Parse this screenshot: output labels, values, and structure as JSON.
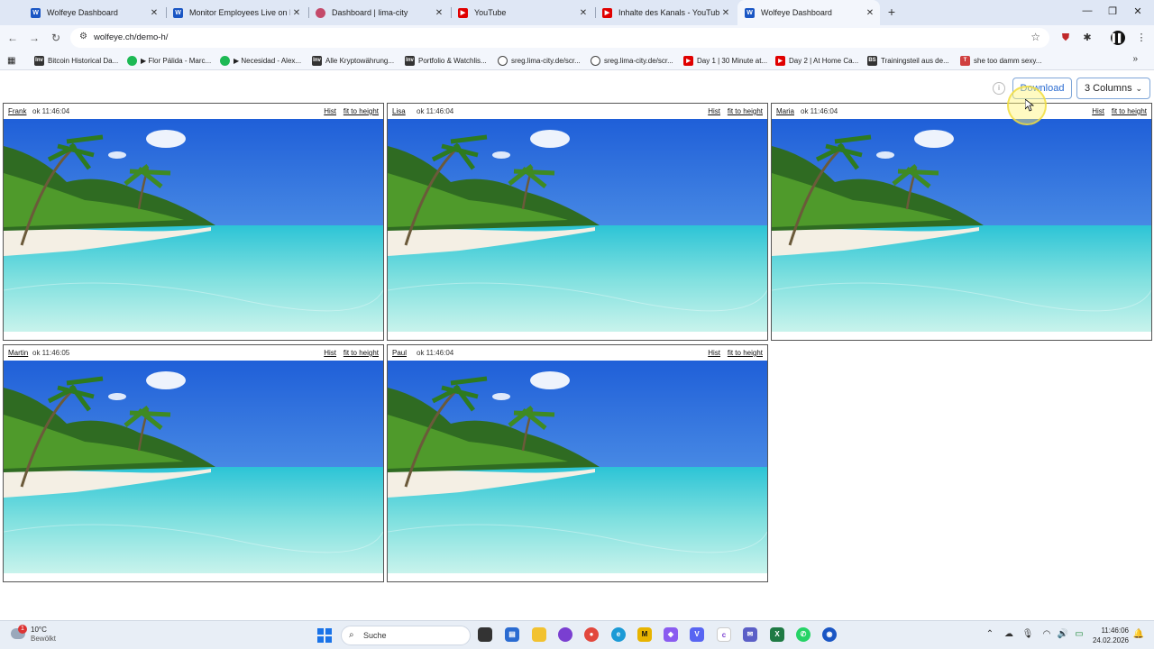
{
  "browser": {
    "tabs": [
      {
        "title": "Wolfeye Dashboard",
        "icon": "wolfeye-icon",
        "color": "#1a56c4",
        "active": false
      },
      {
        "title": "Monitor Employees Live on PC",
        "icon": "wolfeye-icon",
        "color": "#1a56c4",
        "active": false
      },
      {
        "title": "Dashboard | lima-city",
        "icon": "lima-city-icon",
        "color": "#c44a6a",
        "active": false
      },
      {
        "title": "YouTube",
        "icon": "youtube-icon",
        "color": "#e00000",
        "active": false
      },
      {
        "title": "Inhalte des Kanals - YouTube St",
        "icon": "youtube-studio-icon",
        "color": "#e00000",
        "active": false
      },
      {
        "title": "Wolfeye Dashboard",
        "icon": "wolfeye-icon",
        "color": "#1a56c4",
        "active": true
      }
    ],
    "url": "wolfeye.ch/demo-h/",
    "bookmarks": [
      {
        "label": "Bitcoin Historical Da...",
        "icon": "investing-icon",
        "color": "#333333"
      },
      {
        "label": "▶ Flor Pálida - Marc...",
        "icon": "spotify-icon",
        "color": "#1db954"
      },
      {
        "label": "▶ Necesidad - Alex...",
        "icon": "spotify-icon",
        "color": "#1db954"
      },
      {
        "label": "Alle Kryptowährung...",
        "icon": "investing-icon",
        "color": "#333333"
      },
      {
        "label": "Portfolio & Watchlis...",
        "icon": "investing-icon",
        "color": "#333333"
      },
      {
        "label": "sreg.lima-city.de/scr...",
        "icon": "globe-icon",
        "color": "#444444"
      },
      {
        "label": "sreg.lima-city.de/scr...",
        "icon": "globe-icon",
        "color": "#444444"
      },
      {
        "label": "Day 1 | 30 Minute at...",
        "icon": "youtube-icon",
        "color": "#e00000"
      },
      {
        "label": "Day 2 | At Home Ca...",
        "icon": "youtube-icon",
        "color": "#e00000"
      },
      {
        "label": "Trainingsteil aus de...",
        "icon": "bookmark-icon",
        "color": "#333333"
      },
      {
        "label": "she too damm sexy...",
        "icon": "pin-icon",
        "color": "#d04040"
      }
    ]
  },
  "dashboard": {
    "info_label": "i",
    "download_label": "Download",
    "columns_label": "3 Columns",
    "accent": "#2a6bd1",
    "tiles": [
      {
        "name": "Frank",
        "status": "ok 11:46:04",
        "hist": "Hist",
        "fit": "fit to height"
      },
      {
        "name": "Lisa",
        "status": "ok 11:46:04",
        "hist": "Hist",
        "fit": "fit to height"
      },
      {
        "name": "Maria",
        "status": "ok 11:46:04",
        "hist": "Hist",
        "fit": "fit to height"
      },
      {
        "name": "Martin",
        "status": "ok 11:46:05",
        "hist": "Hist",
        "fit": "fit to height"
      },
      {
        "name": "Paul",
        "status": "ok 11:46:04",
        "hist": "Hist",
        "fit": "fit to height"
      }
    ]
  },
  "taskbar": {
    "weather_temp": "10°C",
    "weather_desc": "Bewölkt",
    "weather_badge": "1",
    "search_label": "Suche",
    "time": "11:46:06",
    "date": "24.02.2026"
  }
}
